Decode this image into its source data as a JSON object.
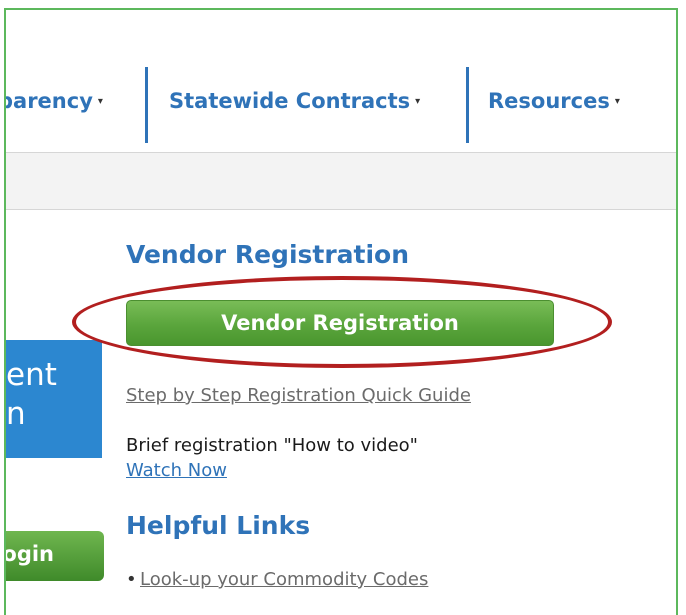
{
  "nav": {
    "items": [
      {
        "label": "parency"
      },
      {
        "label": "Statewide Contracts"
      },
      {
        "label": "Resources"
      }
    ],
    "caret": "▾"
  },
  "left": {
    "panel_line1": "ent",
    "panel_line2": "n",
    "login_label": "ogin"
  },
  "vendor": {
    "heading": "Vendor Registration",
    "button_label": "Vendor Registration",
    "quick_guide": "Step by Step Registration Quick Guide",
    "video_text": "Brief registration \"How to video\"",
    "watch_now": "Watch Now"
  },
  "helpful": {
    "heading": "Helpful Links",
    "links": [
      "Look-up your Commodity Codes"
    ]
  },
  "colors": {
    "brand_blue": "#2f73b8",
    "button_green": "#5aa53c",
    "annotation_red": "#b21f1f",
    "frame_green": "#5cb85c"
  }
}
